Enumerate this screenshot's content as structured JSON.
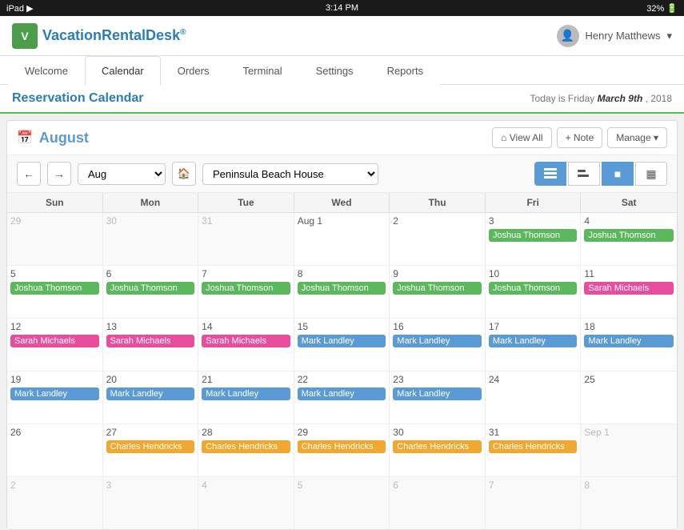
{
  "statusBar": {
    "left": "iPad ▶",
    "center": "3:14 PM",
    "right": "32%  🔋"
  },
  "header": {
    "logoText": "VacationRentalDesk",
    "logoSuperscript": "®",
    "userName": "Henry Matthews",
    "userDropdown": "▾"
  },
  "nav": {
    "tabs": [
      "Welcome",
      "Calendar",
      "Orders",
      "Terminal",
      "Settings",
      "Reports"
    ],
    "activeTab": "Calendar"
  },
  "pageHeader": {
    "title": "Reservation Calendar",
    "todayLabel": "Today is Friday",
    "todayDate": "March 9th",
    "todayYear": ", 2018"
  },
  "calendar": {
    "monthTitle": "August",
    "monthSelectValue": "Aug",
    "propertyName": "Peninsula Beach House",
    "buttons": {
      "viewAll": "⌂ View All",
      "note": "+ Note",
      "manage": "Manage ▾"
    },
    "viewButtons": [
      "📅",
      "🔄",
      "■",
      "▦"
    ],
    "dayHeaders": [
      "Sun",
      "Mon",
      "Tue",
      "Wed",
      "Thu",
      "Fri",
      "Sat"
    ],
    "rows": [
      {
        "days": [
          {
            "num": "29",
            "outside": true,
            "events": []
          },
          {
            "num": "30",
            "outside": true,
            "events": []
          },
          {
            "num": "31",
            "outside": true,
            "events": []
          },
          {
            "num": "Aug 1",
            "outside": false,
            "events": []
          },
          {
            "num": "2",
            "outside": false,
            "events": []
          },
          {
            "num": "3",
            "outside": false,
            "events": [
              {
                "name": "Joshua Thomson",
                "color": "green"
              }
            ]
          },
          {
            "num": "4",
            "outside": false,
            "events": [
              {
                "name": "Joshua Thomson",
                "color": "green"
              }
            ]
          }
        ]
      },
      {
        "days": [
          {
            "num": "5",
            "outside": false,
            "events": [
              {
                "name": "Joshua Thomson",
                "color": "green"
              }
            ]
          },
          {
            "num": "6",
            "outside": false,
            "events": [
              {
                "name": "Joshua Thomson",
                "color": "green"
              }
            ]
          },
          {
            "num": "7",
            "outside": false,
            "events": [
              {
                "name": "Joshua Thomson",
                "color": "green"
              }
            ]
          },
          {
            "num": "8",
            "outside": false,
            "events": [
              {
                "name": "Joshua Thomson",
                "color": "green"
              }
            ]
          },
          {
            "num": "9",
            "outside": false,
            "events": [
              {
                "name": "Joshua Thomson",
                "color": "green"
              }
            ]
          },
          {
            "num": "10",
            "outside": false,
            "events": [
              {
                "name": "Joshua Thomson",
                "color": "green"
              }
            ]
          },
          {
            "num": "11",
            "outside": false,
            "events": [
              {
                "name": "Sarah Michaels",
                "color": "pink"
              }
            ]
          }
        ]
      },
      {
        "days": [
          {
            "num": "12",
            "outside": false,
            "events": [
              {
                "name": "Sarah Michaels",
                "color": "pink"
              }
            ]
          },
          {
            "num": "13",
            "outside": false,
            "events": [
              {
                "name": "Sarah Michaels",
                "color": "pink"
              }
            ]
          },
          {
            "num": "14",
            "outside": false,
            "events": [
              {
                "name": "Sarah Michaels",
                "color": "pink"
              }
            ]
          },
          {
            "num": "15",
            "outside": false,
            "events": [
              {
                "name": "Mark Landley",
                "color": "blue"
              }
            ]
          },
          {
            "num": "16",
            "outside": false,
            "events": [
              {
                "name": "Mark Landley",
                "color": "blue"
              }
            ]
          },
          {
            "num": "17",
            "outside": false,
            "events": [
              {
                "name": "Mark Landley",
                "color": "blue"
              }
            ]
          },
          {
            "num": "18",
            "outside": false,
            "events": [
              {
                "name": "Mark Landley",
                "color": "blue"
              }
            ]
          }
        ]
      },
      {
        "days": [
          {
            "num": "19",
            "outside": false,
            "events": [
              {
                "name": "Mark Landley",
                "color": "blue"
              }
            ]
          },
          {
            "num": "20",
            "outside": false,
            "events": [
              {
                "name": "Mark Landley",
                "color": "blue"
              }
            ]
          },
          {
            "num": "21",
            "outside": false,
            "events": [
              {
                "name": "Mark Landley",
                "color": "blue"
              }
            ]
          },
          {
            "num": "22",
            "outside": false,
            "events": [
              {
                "name": "Mark Landley",
                "color": "blue"
              }
            ]
          },
          {
            "num": "23",
            "outside": false,
            "events": [
              {
                "name": "Mark Landley",
                "color": "blue"
              }
            ]
          },
          {
            "num": "24",
            "outside": false,
            "events": []
          },
          {
            "num": "25",
            "outside": false,
            "events": []
          }
        ]
      },
      {
        "days": [
          {
            "num": "26",
            "outside": false,
            "events": []
          },
          {
            "num": "27",
            "outside": false,
            "events": [
              {
                "name": "Charles Hendricks",
                "color": "yellow"
              }
            ]
          },
          {
            "num": "28",
            "outside": false,
            "events": [
              {
                "name": "Charles Hendricks",
                "color": "yellow"
              }
            ]
          },
          {
            "num": "29",
            "outside": false,
            "events": [
              {
                "name": "Charles Hendricks",
                "color": "yellow"
              }
            ]
          },
          {
            "num": "30",
            "outside": false,
            "events": [
              {
                "name": "Charles Hendricks",
                "color": "yellow"
              }
            ]
          },
          {
            "num": "31",
            "outside": false,
            "events": [
              {
                "name": "Charles Hendricks",
                "color": "yellow"
              }
            ]
          },
          {
            "num": "Sep 1",
            "outside": true,
            "events": []
          }
        ]
      },
      {
        "days": [
          {
            "num": "2",
            "outside": true,
            "events": []
          },
          {
            "num": "3",
            "outside": true,
            "events": []
          },
          {
            "num": "4",
            "outside": true,
            "events": []
          },
          {
            "num": "5",
            "outside": true,
            "events": []
          },
          {
            "num": "6",
            "outside": true,
            "events": []
          },
          {
            "num": "7",
            "outside": true,
            "events": []
          },
          {
            "num": "8",
            "outside": true,
            "events": []
          }
        ]
      }
    ]
  }
}
